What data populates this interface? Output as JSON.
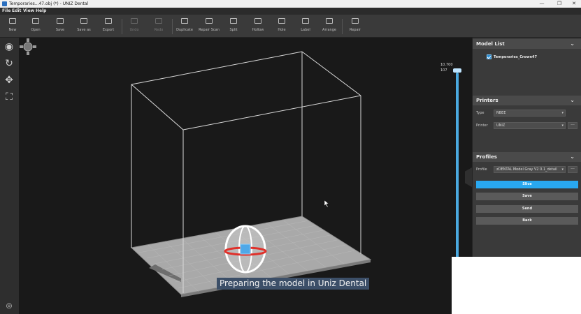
{
  "window": {
    "title": "Temporaries...47.obj (*) - UNIZ Dental",
    "min_glyph": "—",
    "max_glyph": "❐",
    "close_glyph": "✕"
  },
  "menu": [
    "File",
    "Edit",
    "View",
    "Help"
  ],
  "toolbar": {
    "new": "New",
    "open": "Open",
    "save": "Save",
    "save_as": "Save as",
    "export": "Export",
    "undo": "Undo",
    "redo": "Redo",
    "duplicate": "Duplicate",
    "repair_scan": "Repair Scan",
    "split": "Split",
    "hollow": "Hollow",
    "hole": "Hole",
    "label": "Label",
    "arrange": "Arrange",
    "repair": "Repair"
  },
  "left_tools": [
    "view-icon",
    "rotate-icon",
    "move-icon",
    "scale-icon"
  ],
  "viewport": {
    "layer_top": "10.700",
    "layer_count": "107",
    "caption": "Preparing the model in Uniz Dental"
  },
  "model_list": {
    "header": "Model List",
    "item": "Temporaries_Crown47",
    "checked": true
  },
  "printers": {
    "header": "Printers",
    "type_label": "Type",
    "type_value": "NBEE",
    "printer_label": "Printer",
    "printer_value": "UNIZ"
  },
  "profiles": {
    "header": "Profiles",
    "profile_label": "Profile",
    "profile_value": "zDENTAL Model Gray V2 0.1_detail",
    "buttons": {
      "slice": "Slice",
      "save": "Save",
      "send": "Send",
      "back": "Back"
    }
  },
  "colors": {
    "accent": "#29a8f0",
    "panel": "#3a3a3a",
    "viewport": "#191919"
  }
}
